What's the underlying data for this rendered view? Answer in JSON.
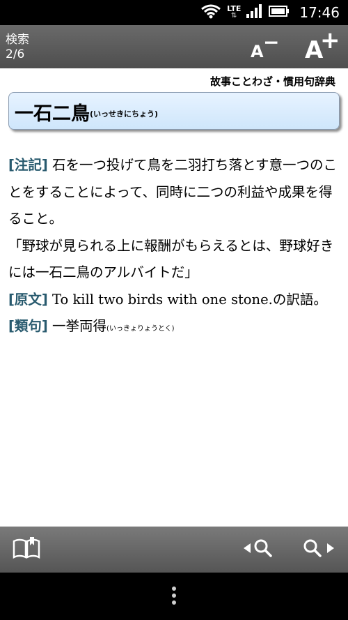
{
  "status_bar": {
    "network": "LTE",
    "time": "17:46",
    "icons": [
      "wifi-icon",
      "lte-data-icon",
      "signal-icon",
      "battery-icon"
    ]
  },
  "header": {
    "title": "検索",
    "position": "2/6",
    "font_smaller_icon": "font-smaller-icon",
    "font_larger_icon": "font-larger-icon"
  },
  "entry": {
    "dictionary_name": "故事ことわざ・慣用句辞典",
    "headword": "一石二鳥",
    "reading": "(いっせきにちょう)",
    "note_label": "[注記]",
    "note_text": "石を一つ投げて鳥を二羽打ち落とす意一つのことをすることによって、同時に二つの利益や成果を得ること。",
    "example_text": "「野球が見られる上に報酬がもらえるとは、野球好きには一石二鳥のアルバイトだ」",
    "origin_label": "[原文]",
    "origin_english": "To kill two birds with one stone.",
    "origin_suffix": "の訳語。",
    "similar_label": "[類句]",
    "similar_word": "一挙両得",
    "similar_reading": "(いっきょりょうとく)"
  },
  "toolbar": {
    "book_icon": "book-icon",
    "prev_icon": "search-prev-icon",
    "next_icon": "search-next-icon"
  },
  "nav": {
    "menu_icon": "menu-dots-icon"
  },
  "colors": {
    "label": "#285a6e",
    "headword_bg": "#d8ebfd",
    "header_bg": "#5c5c5c"
  }
}
